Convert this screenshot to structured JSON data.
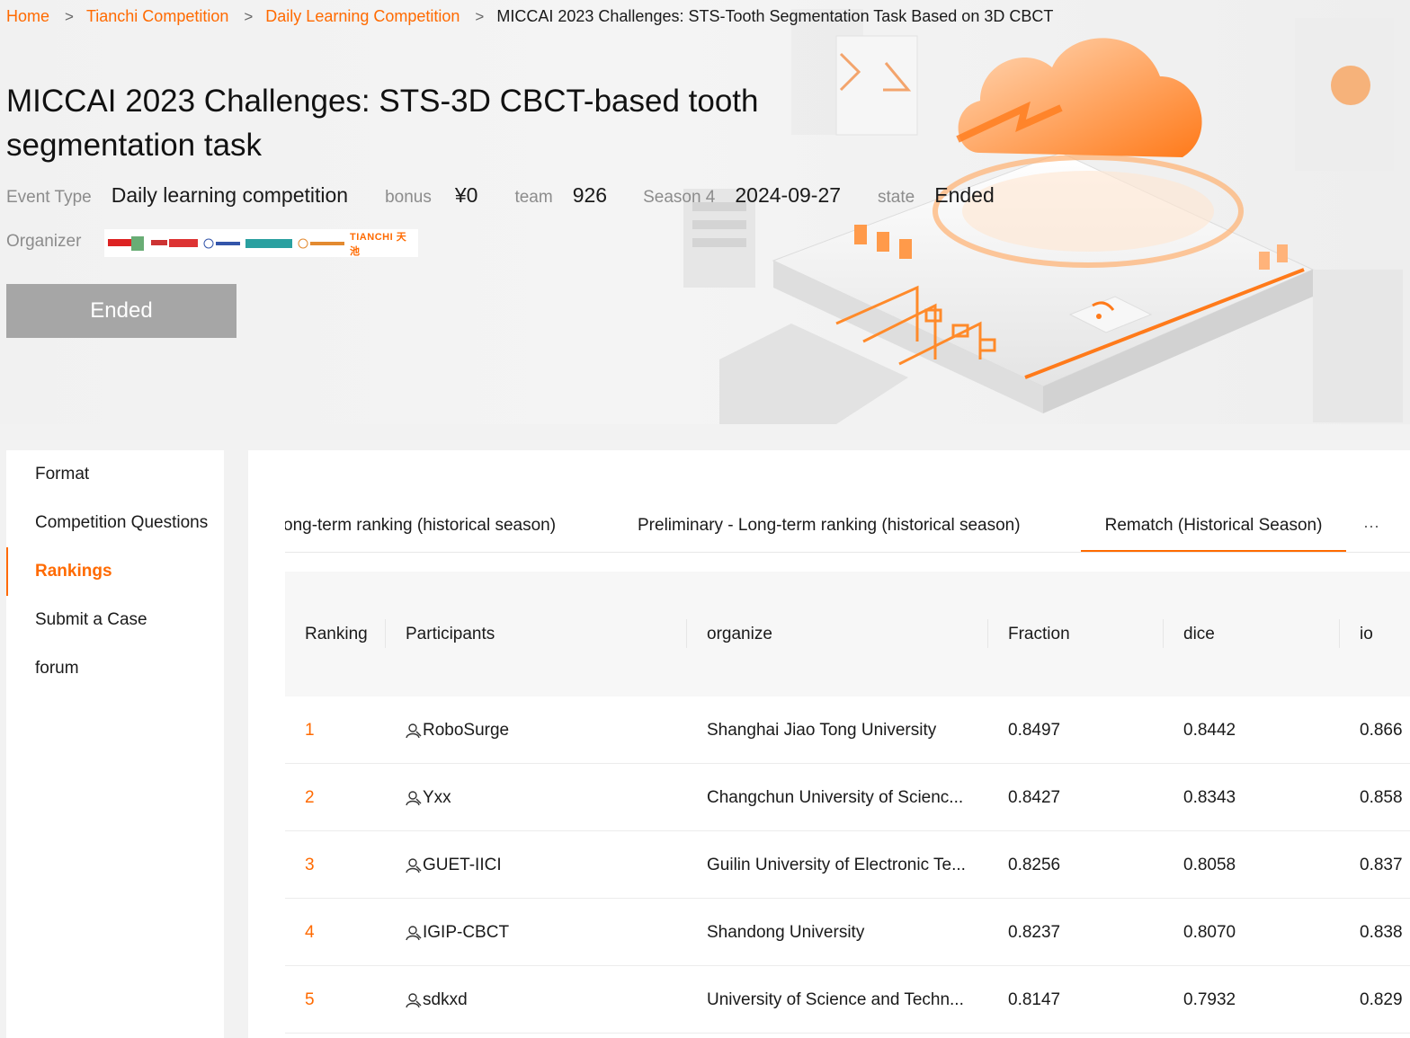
{
  "breadcrumb": {
    "home": "Home",
    "tianchi": "Tianchi Competition",
    "daily": "Daily Learning Competition",
    "current": "MICCAI 2023 Challenges: STS-Tooth Segmentation Task Based on 3D CBCT",
    "separator": ">"
  },
  "header": {
    "title": "MICCAI 2023 Challenges: STS-3D CBCT-based tooth segmentation task",
    "event_type_label": "Event Type",
    "event_type": "Daily learning competition",
    "bonus_label": "bonus",
    "bonus": "¥0",
    "team_label": "team",
    "team": "926",
    "season_label": "Season 4",
    "season_date": "2024-09-27",
    "state_label": "state",
    "state": "Ended",
    "organizer_label": "Organizer",
    "organizer_logo_text": "TIANCHI 天池",
    "button_label": "Ended"
  },
  "sidebar": {
    "items": [
      {
        "label": "Format"
      },
      {
        "label": "Competition Questions"
      },
      {
        "label": "Rankings"
      },
      {
        "label": "Submit a Case"
      },
      {
        "label": "forum"
      }
    ],
    "active_index": 2
  },
  "tabs": {
    "items": [
      {
        "label": "ong-term ranking (historical season)"
      },
      {
        "label": "Preliminary - Long-term ranking (historical season)"
      },
      {
        "label": "Rematch (Historical Season)"
      }
    ],
    "active_index": 2,
    "more": "···"
  },
  "table": {
    "columns": [
      "Ranking",
      "Participants",
      "organize",
      "Fraction",
      "dice",
      "io"
    ],
    "rows": [
      {
        "rank": "1",
        "participant": "RoboSurge",
        "organize": "Shanghai Jiao Tong University",
        "fraction": "0.8497",
        "dice": "0.8442",
        "io": "0.866"
      },
      {
        "rank": "2",
        "participant": "Yxx",
        "organize": "Changchun University of Scienc...",
        "fraction": "0.8427",
        "dice": "0.8343",
        "io": "0.858"
      },
      {
        "rank": "3",
        "participant": "GUET-IICI",
        "organize": "Guilin University of Electronic Te...",
        "fraction": "0.8256",
        "dice": "0.8058",
        "io": "0.837"
      },
      {
        "rank": "4",
        "participant": "IGIP-CBCT",
        "organize": "Shandong University",
        "fraction": "0.8237",
        "dice": "0.8070",
        "io": "0.838"
      },
      {
        "rank": "5",
        "participant": "sdkxd",
        "organize": "University of Science and Techn...",
        "fraction": "0.8147",
        "dice": "0.7932",
        "io": "0.829"
      }
    ]
  },
  "colors": {
    "accent": "#ff6a00",
    "button_disabled": "#a6a6a6",
    "page_bg": "#f2f2f2"
  }
}
